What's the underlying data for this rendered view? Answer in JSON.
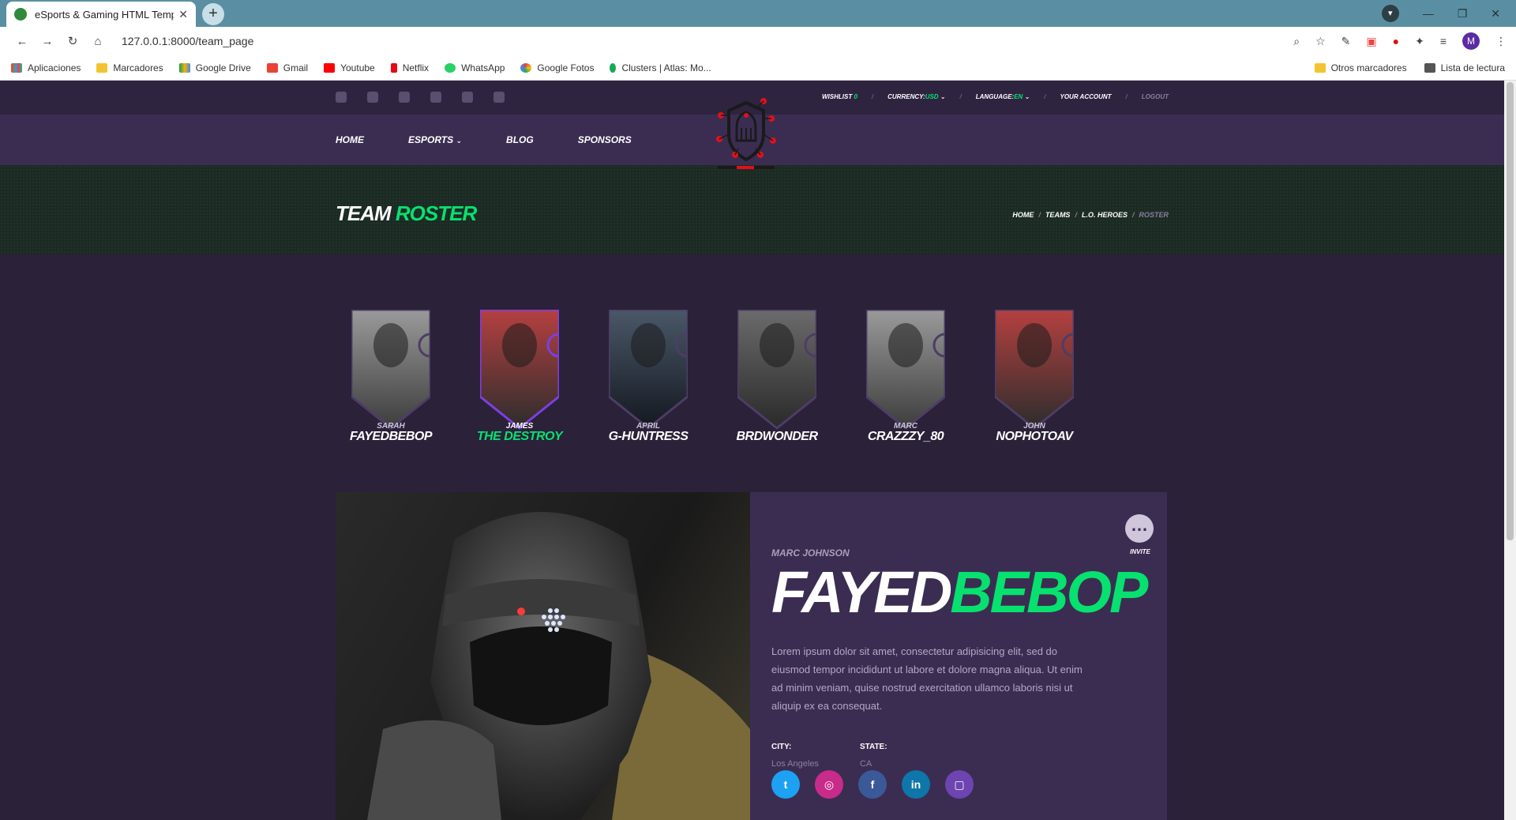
{
  "browser": {
    "tab_title": "eSports & Gaming HTML Templa",
    "url": "127.0.0.1:8000/team_page",
    "bookmarks": [
      "Aplicaciones",
      "Marcadores",
      "Google Drive",
      "Gmail",
      "Youtube",
      "Netflix",
      "WhatsApp",
      "Google Fotos",
      "Clusters | Atlas: Mo..."
    ],
    "bookmarks_right": [
      "Otros marcadores",
      "Lista de lectura"
    ],
    "profile_initial": "M"
  },
  "topbar": {
    "wishlist_label": "WISHLIST",
    "wishlist_count": "0",
    "currency_label": "CURRENCY:",
    "currency_value": "USD",
    "language_label": "LANGUAGE:",
    "language_value": "EN",
    "account": "YOUR ACCOUNT",
    "logout": "LOGOUT",
    "social_icons": [
      "facebook-icon",
      "twitter-icon",
      "twitch-icon",
      "youtube-icon",
      "linkedin-icon",
      "instagram-icon"
    ]
  },
  "nav": {
    "items": [
      "HOME",
      "ESPORTS",
      "BLOG",
      "SPONSORS"
    ]
  },
  "hero": {
    "title_a": "TEAM",
    "title_b": "ROSTER",
    "breadcrumbs": [
      "HOME",
      "TEAMS",
      "L.O. HEROES",
      "ROSTER"
    ]
  },
  "roster": [
    {
      "first": "SARAH",
      "nick": "FAYEDBEBOP",
      "active": false
    },
    {
      "first": "JAMES",
      "nick": "THE DESTROY",
      "active": true
    },
    {
      "first": "APRIL",
      "nick": "G-HUNTRESS",
      "active": false
    },
    {
      "first": "",
      "nick": "BRDWONDER",
      "active": false
    },
    {
      "first": "MARC",
      "nick": "CRAZZZY_80",
      "active": false
    },
    {
      "first": "JOHN",
      "nick": "NOPHOTOAV",
      "active": false
    }
  ],
  "profile": {
    "real_name": "MARC JOHNSON",
    "nick_a": "FAYED",
    "nick_b": "BEBOP",
    "bio": "Lorem ipsum dolor sit amet, consectetur adipisicing elit, sed do eiusmod tempor incididunt ut labore et dolore magna aliqua. Ut enim ad minim veniam, quise nostrud exercitation ullamco laboris nisi ut aliquip ex ea consequat.",
    "city_label": "CITY:",
    "city": "Los Angeles",
    "state_label": "STATE:",
    "state": "CA",
    "invite": "INVITE",
    "socials": [
      {
        "name": "twitter-icon",
        "glyph": "t",
        "color": "#1da1f2"
      },
      {
        "name": "instagram-icon",
        "glyph": "◎",
        "color": "#c92b8a"
      },
      {
        "name": "facebook-icon",
        "glyph": "f",
        "color": "#3b5998"
      },
      {
        "name": "linkedin-icon",
        "glyph": "in",
        "color": "#0e76a8"
      },
      {
        "name": "twitch-icon",
        "glyph": "▢",
        "color": "#6e44b0"
      }
    ]
  },
  "colors": {
    "accent": "#07e16f",
    "purple": "#3b2d52",
    "bg": "#2b2139"
  }
}
